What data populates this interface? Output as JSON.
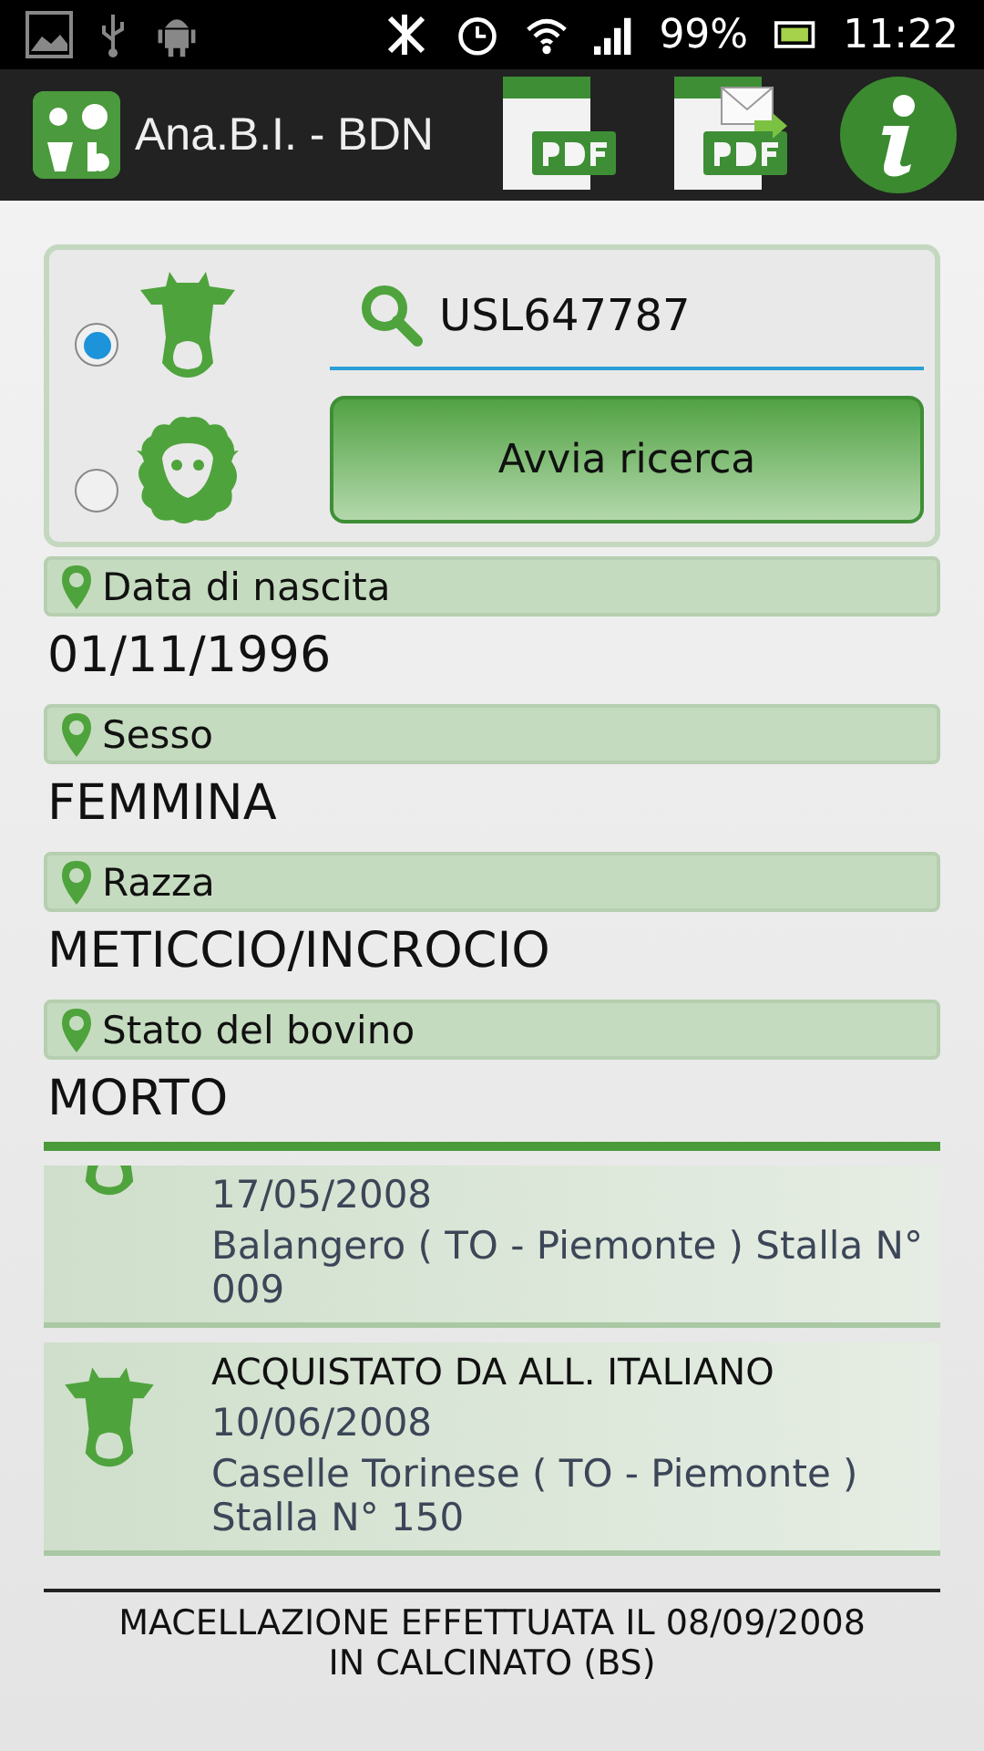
{
  "status_bar": {
    "battery": "99%",
    "time": "11:22"
  },
  "app_bar": {
    "title": "Ana.B.I. - BDN"
  },
  "search": {
    "species": [
      {
        "kind": "cattle",
        "selected": true
      },
      {
        "kind": "sheep",
        "selected": false
      }
    ],
    "value": "USL647787",
    "button": "Avvia ricerca"
  },
  "fields": [
    {
      "label": "Data di nascita",
      "value": "01/11/1996"
    },
    {
      "label": "Sesso",
      "value": "FEMMINA"
    },
    {
      "label": "Razza",
      "value": "METICCIO/INCROCIO"
    },
    {
      "label": "Stato del bovino",
      "value": "MORTO"
    }
  ],
  "events": [
    {
      "date": "17/05/2008",
      "place": "Balangero ( TO - Piemonte ) Stalla N° 009"
    },
    {
      "title": "ACQUISTATO DA ALL. ITALIANO",
      "date": "10/06/2008",
      "place": "Caselle Torinese ( TO - Piemonte ) Stalla N° 150"
    }
  ],
  "footer": "MACELLAZIONE EFFETTUATA IL 08/09/2008 IN CALCINATO (BS)"
}
